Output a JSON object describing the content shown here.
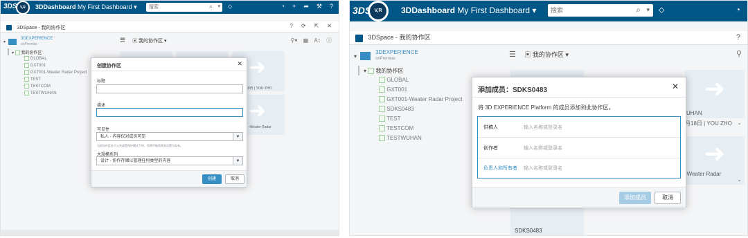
{
  "left": {
    "app": {
      "brand": "3DS",
      "compass": "V,R",
      "title": "3DDashboard",
      "dashboard": "My First Dashboard",
      "search_placeholder": "搜索"
    },
    "subheader": {
      "title": "3DSpace - 我的协作区",
      "icons": [
        "?",
        "⟳",
        "⇱",
        "✕"
      ]
    },
    "tree": {
      "root_label": "3DEXPERIENCE",
      "root_sub": "onPremise",
      "my_spaces": "我的协作区",
      "items": [
        "GLOBAL",
        "GXT001",
        "GXT001-Weater Radar Project",
        "TEST",
        "TESTCOM",
        "TESTWUHAN"
      ]
    },
    "toolbar": {
      "menu": "☰",
      "my_spaces": "我的协作区"
    },
    "tiles": [
      {
        "caption": ""
      },
      {
        "caption": ""
      },
      {
        "caption": "18日 | YOU ZHO"
      },
      {
        "caption": ""
      },
      {
        "caption": ""
      },
      {
        "caption": "-Weater Radar"
      }
    ],
    "dialog": {
      "title": "创建协作区",
      "title_label": "标题",
      "desc_label": "描述",
      "visibility_label": "可见性",
      "visibility_value": "私人 - 内容仅对成员可见",
      "visibility_help": "当前协作区处于公共或受保护模式下时，您将不能再将其设置为私有。",
      "family_label": "大规模系列",
      "family_value": "设计 - 协作存储以管理任何类型的内容",
      "create": "创建",
      "cancel": "取消"
    }
  },
  "right": {
    "app": {
      "brand": "3DS",
      "compass": "V,R",
      "title": "3DDashboard",
      "dashboard": "My First Dashboard",
      "search_placeholder": "搜索"
    },
    "subheader": {
      "title": "3DSpace - 我的协作区",
      "help": "?"
    },
    "tree": {
      "root_label": "3DEXPERIENCE",
      "root_sub": "onPremise",
      "my_spaces": "我的协作区",
      "items": [
        "GLOBAL",
        "GXT001",
        "GXT001-Weater Radar Project",
        "SDKS0483",
        "TEST",
        "TESTCOM",
        "TESTWUHAN"
      ]
    },
    "toolbar": {
      "menu": "☰",
      "my_spaces": "我的协作区"
    },
    "tiles": [
      {
        "caption": ""
      },
      {
        "caption": "UHAN"
      },
      {
        "caption": "月18日 | YOU ZHO"
      },
      {
        "caption": "-Weater Radar"
      },
      {
        "caption": "SDKS0483"
      }
    ],
    "dialog": {
      "title": "添加成员：SDKS0483",
      "intro": "将 3D EXPERIENCE Platform 的成员添加到此协作区。",
      "rows": [
        {
          "label": "供稿人",
          "placeholder": "输入名称或登录名"
        },
        {
          "label": "创作者",
          "placeholder": "输入名称或登录名"
        },
        {
          "label": "负责人和所有者",
          "placeholder": "输入名称或登录名"
        }
      ],
      "add": "添加成员",
      "cancel": "取消"
    }
  }
}
